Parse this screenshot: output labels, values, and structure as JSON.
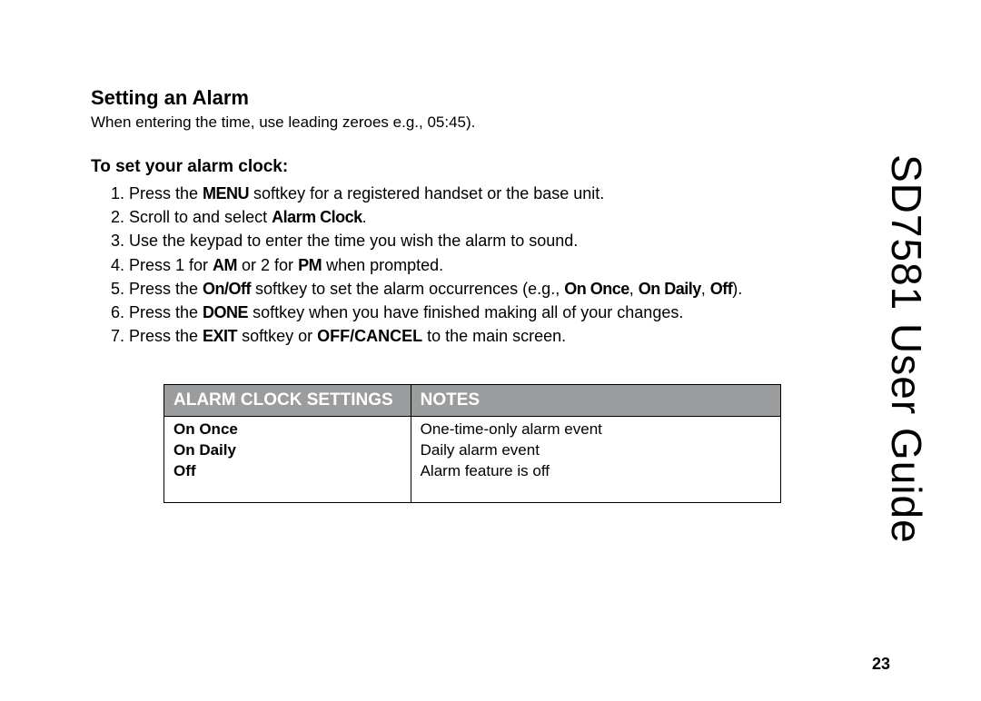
{
  "section_title": "Setting an Alarm",
  "intro": "When entering the time, use leading zeroes e.g., 05:45).",
  "subhead": "To set your alarm clock:",
  "steps": {
    "s1_a": "Press the ",
    "s1_b": "MENU",
    "s1_c": " softkey for a registered handset or the base unit.",
    "s2_a": "Scroll to and select ",
    "s2_b": "Alarm Clock",
    "s2_c": ".",
    "s3": "Use the keypad to enter the time you wish the alarm to sound.",
    "s4_a": "Press 1 for ",
    "s4_b": "AM",
    "s4_c": " or 2 for ",
    "s4_d": "PM",
    "s4_e": " when prompted.",
    "s5_a": "Press the ",
    "s5_b": "On/Off",
    "s5_c": " softkey to set the alarm occurrences (e.g., ",
    "s5_d": "On Once",
    "s5_e": ", ",
    "s5_f": "On Daily",
    "s5_g": ", ",
    "s5_h": "Off",
    "s5_i": ").",
    "s6_a": "Press the ",
    "s6_b": "DONE",
    "s6_c": " softkey when you have finished making all of your changes.",
    "s7_a": "Press the ",
    "s7_b": "EXIT",
    "s7_c": " softkey or ",
    "s7_d": "OFF/CANCEL",
    "s7_e": " to the main screen."
  },
  "table": {
    "header_col1": "Alarm Clock Settings",
    "header_col2": "Notes",
    "row1_c1": "On Once",
    "row1_c2": "One-time-only alarm event",
    "row2_c1": "On Daily",
    "row2_c2": "Daily alarm event",
    "row3_c1": "Off",
    "row3_c2": "Alarm feature is off"
  },
  "side_title_bold": "SD7581",
  "side_title_rest": " User Guide",
  "page_number": "23"
}
